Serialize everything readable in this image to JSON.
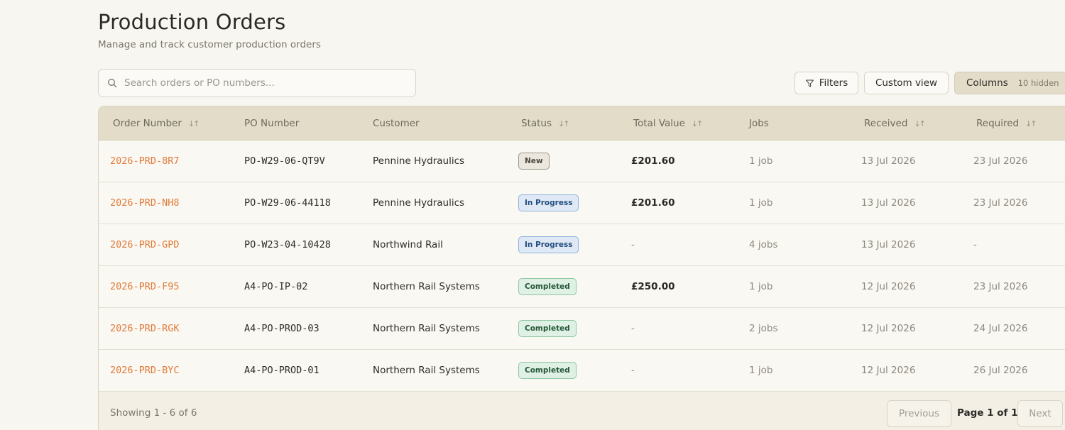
{
  "header": {
    "title": "Production Orders",
    "subtitle": "Manage and track customer production orders"
  },
  "toolbar": {
    "search_placeholder": "Search orders or PO numbers...",
    "search_value": "",
    "filters_label": "Filters",
    "custom_view_label": "Custom view",
    "columns_label": "Columns",
    "columns_hidden": "10 hidden"
  },
  "table": {
    "columns": [
      {
        "label": "Order Number",
        "sortable": true
      },
      {
        "label": "PO Number",
        "sortable": false
      },
      {
        "label": "Customer",
        "sortable": false
      },
      {
        "label": "Status",
        "sortable": true
      },
      {
        "label": "Total Value",
        "sortable": true
      },
      {
        "label": "Jobs",
        "sortable": false
      },
      {
        "label": "Received",
        "sortable": true
      },
      {
        "label": "Required",
        "sortable": true
      }
    ],
    "rows": [
      {
        "order": "2026-PRD-8R7",
        "po": "PO-W29-06-QT9V",
        "customer": "Pennine Hydraulics",
        "status": "New",
        "status_type": "new",
        "value": "£201.60",
        "jobs": "1 job",
        "received": "13 Jul 2026",
        "required": "23 Jul 2026"
      },
      {
        "order": "2026-PRD-NH8",
        "po": "PO-W29-06-44118",
        "customer": "Pennine Hydraulics",
        "status": "In Progress",
        "status_type": "progress",
        "value": "£201.60",
        "jobs": "1 job",
        "received": "13 Jul 2026",
        "required": "23 Jul 2026"
      },
      {
        "order": "2026-PRD-GPD",
        "po": "PO-W23-04-10428",
        "customer": "Northwind Rail",
        "status": "In Progress",
        "status_type": "progress",
        "value": "-",
        "jobs": "4 jobs",
        "received": "13 Jul 2026",
        "required": "-"
      },
      {
        "order": "2026-PRD-F95",
        "po": "A4-PO-IP-02",
        "customer": "Northern Rail Systems",
        "status": "Completed",
        "status_type": "completed",
        "value": "£250.00",
        "jobs": "1 job",
        "received": "12 Jul 2026",
        "required": "23 Jul 2026"
      },
      {
        "order": "2026-PRD-RGK",
        "po": "A4-PO-PROD-03",
        "customer": "Northern Rail Systems",
        "status": "Completed",
        "status_type": "completed",
        "value": "-",
        "jobs": "2 jobs",
        "received": "12 Jul 2026",
        "required": "24 Jul 2026"
      },
      {
        "order": "2026-PRD-BYC",
        "po": "A4-PO-PROD-01",
        "customer": "Northern Rail Systems",
        "status": "Completed",
        "status_type": "completed",
        "value": "-",
        "jobs": "1 job",
        "received": "12 Jul 2026",
        "required": "26 Jul 2026"
      }
    ]
  },
  "footer": {
    "showing": "Showing 1 - 6 of 6",
    "previous_label": "Previous",
    "page_label": "Page 1 of 1",
    "next_label": "Next"
  },
  "colors": {
    "accent": "#e07b3a",
    "header_bg": "#e3dcc8",
    "page_bg": "#f8f6f0"
  },
  "icons": {
    "search": "search-icon",
    "filters": "filter-icon",
    "sort": "sort-arrows-icon"
  }
}
